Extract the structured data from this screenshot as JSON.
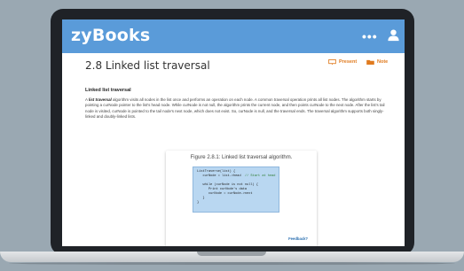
{
  "app": {
    "logo": "zyBooks",
    "menu_label": "•••",
    "user_icon": "user-icon"
  },
  "section": {
    "title": "2.8 Linked list traversal",
    "actions": [
      {
        "label": "Present",
        "icon": "present-icon"
      },
      {
        "label": "Note",
        "icon": "folder-icon"
      }
    ],
    "subheading": "Linked list traversal",
    "paragraph": {
      "prefix": "A ",
      "term": "list traversal",
      "body": " algorithm visits all nodes in the list once and performs an operation on each node. A common traversal operation prints all list nodes. The algorithm starts by pointing a curNode pointer to the list's head node. While curNode is not null, the algorithm prints the current node, and then points curNode to the next node. After the list's tail node is visited, curNode is pointed to the tail node's next node, which does not exist. So, curNode is null, and the traversal ends. The traversal algorithm supports both singly-linked and doubly-linked lists."
    }
  },
  "figure": {
    "caption": "Figure 2.8.1: Linked list traversal algorithm.",
    "code_lines": [
      {
        "text": "ListTraverse(list) {",
        "comment": ""
      },
      {
        "text": "   curNode = list->head",
        "comment": "  // Start at head"
      },
      {
        "text": "",
        "comment": ""
      },
      {
        "text": "   while (curNode is not null) {",
        "comment": ""
      },
      {
        "text": "      Print curNode's data",
        "comment": ""
      },
      {
        "text": "      curNode = curNode->next",
        "comment": ""
      },
      {
        "text": "   }",
        "comment": ""
      },
      {
        "text": "}",
        "comment": ""
      }
    ],
    "feedback_label": "Feedback?"
  },
  "colors": {
    "topbar": "#5a9bd9",
    "accent": "#e07b1f",
    "code_bg": "#b9d7f1"
  }
}
